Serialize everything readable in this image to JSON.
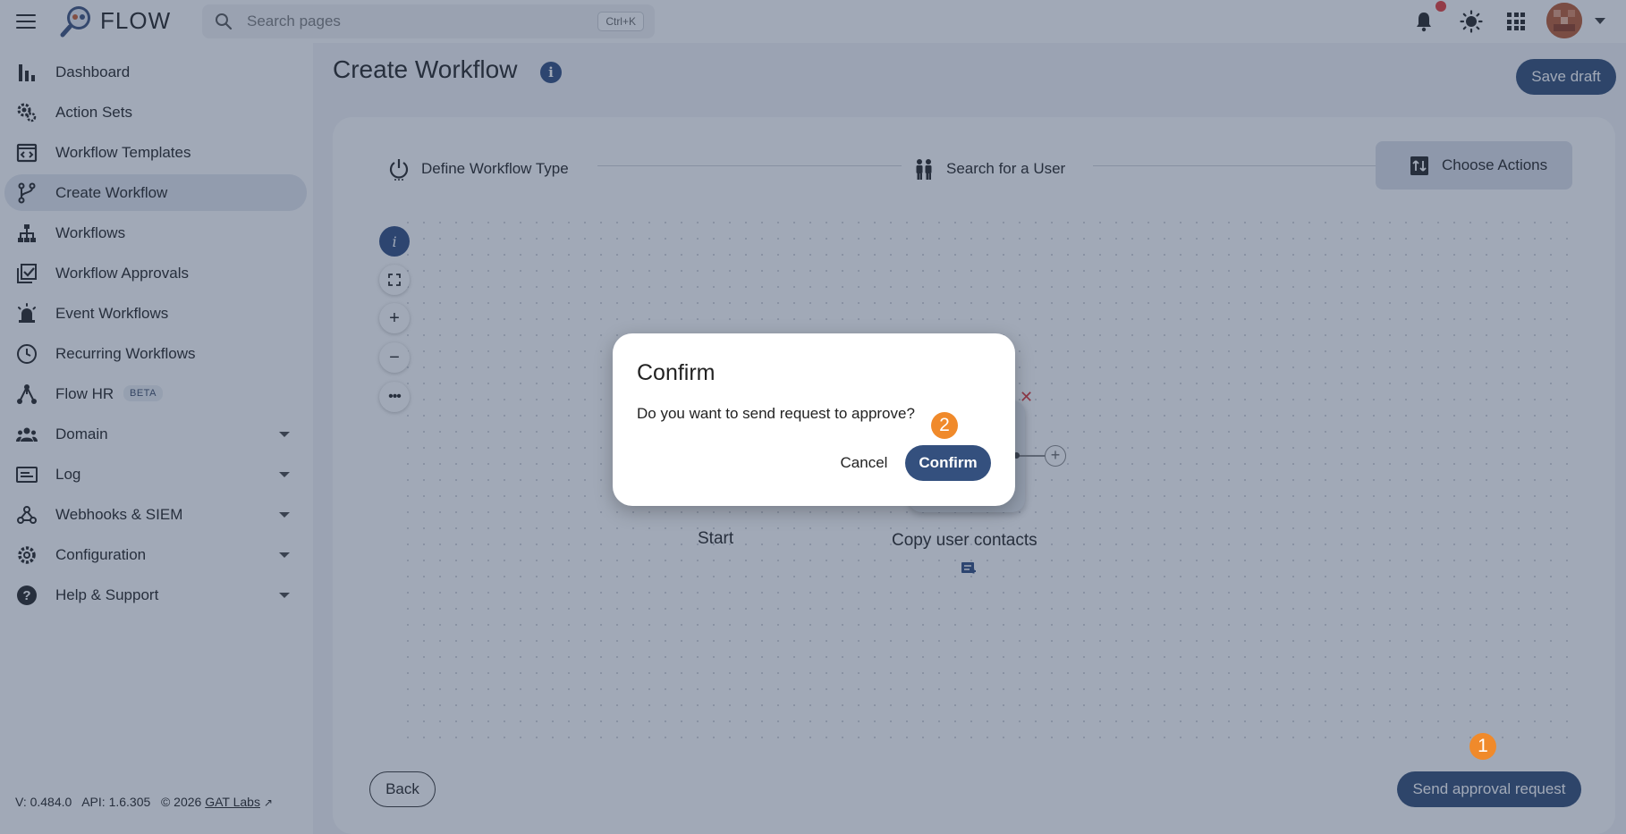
{
  "app": {
    "name": "FLOW"
  },
  "search": {
    "placeholder": "Search pages",
    "shortcut": "Ctrl+K"
  },
  "sidebar": {
    "items": [
      {
        "label": "Dashboard",
        "icon": "bar-chart-icon"
      },
      {
        "label": "Action Sets",
        "icon": "gears-icon"
      },
      {
        "label": "Workflow Templates",
        "icon": "template-icon"
      },
      {
        "label": "Create Workflow",
        "icon": "fork-icon",
        "active": true
      },
      {
        "label": "Workflows",
        "icon": "hierarchy-icon"
      },
      {
        "label": "Workflow Approvals",
        "icon": "approval-check-icon"
      },
      {
        "label": "Event Workflows",
        "icon": "alarm-light-icon"
      },
      {
        "label": "Recurring Workflows",
        "icon": "clock-icon"
      },
      {
        "label": "Flow HR",
        "icon": "network-icon",
        "badge": "BETA"
      },
      {
        "label": "Domain",
        "icon": "people-icon",
        "expandable": true
      },
      {
        "label": "Log",
        "icon": "log-icon",
        "expandable": true
      },
      {
        "label": "Webhooks & SIEM",
        "icon": "webhook-icon",
        "expandable": true
      },
      {
        "label": "Configuration",
        "icon": "gear-icon",
        "expandable": true
      },
      {
        "label": "Help & Support",
        "icon": "help-icon",
        "expandable": true
      }
    ],
    "footer": {
      "version": "V: 0.484.0",
      "api": "API: 1.6.305",
      "copyright": "© 2026",
      "company": "GAT Labs"
    }
  },
  "page": {
    "title": "Create Workflow",
    "save_draft": "Save draft",
    "steps": [
      {
        "label": "Define Workflow Type",
        "icon": "power-icon"
      },
      {
        "label": "Search for a User",
        "icon": "users-icon"
      },
      {
        "label": "Choose Actions",
        "icon": "actions-icon",
        "active": true
      }
    ],
    "canvas": {
      "nodes": [
        {
          "label": "Start"
        },
        {
          "label": "Copy user contacts"
        }
      ]
    },
    "back": "Back",
    "send": "Send approval request"
  },
  "dialog": {
    "title": "Confirm",
    "message": "Do you want to send request to approve?",
    "cancel": "Cancel",
    "confirm": "Confirm"
  },
  "annotations": {
    "badge_1": "1",
    "badge_2": "2"
  },
  "colors": {
    "primary": "#2f4a74",
    "badge": "#f08a2b",
    "bell_dot": "#e53935"
  }
}
